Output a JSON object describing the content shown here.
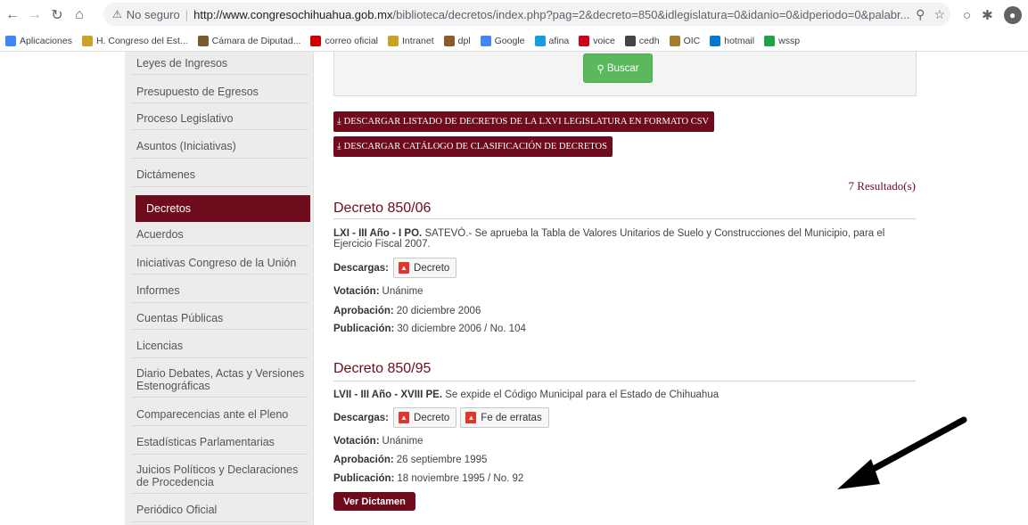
{
  "browser": {
    "security_label": "No seguro",
    "url_host": "http://www.congresochihuahua.gob.mx",
    "url_path": "/biblioteca/decretos/index.php?pag=2&decreto=850&idlegislatura=0&idanio=0&idperiodo=0&palabr...",
    "bookmarks": [
      {
        "label": "Aplicaciones",
        "color": "#4285f4"
      },
      {
        "label": "H. Congreso del Est...",
        "color": "#c9a227"
      },
      {
        "label": "Cámara de Diputad...",
        "color": "#7a5b2e"
      },
      {
        "label": "correo oficial",
        "color": "#cc0000"
      },
      {
        "label": "Intranet",
        "color": "#c9a227"
      },
      {
        "label": "dpl",
        "color": "#8a5a2b"
      },
      {
        "label": "Google",
        "color": "#4285f4"
      },
      {
        "label": "afina",
        "color": "#1a9be0"
      },
      {
        "label": "voice",
        "color": "#d0021b"
      },
      {
        "label": "cedh",
        "color": "#444444"
      },
      {
        "label": "OIC",
        "color": "#a57d2c"
      },
      {
        "label": "hotmail",
        "color": "#0078d4"
      },
      {
        "label": "wssp",
        "color": "#1ea446"
      }
    ]
  },
  "sidebar": {
    "items": [
      {
        "label": "Leyes de Ingresos",
        "active": false
      },
      {
        "label": "Presupuesto de Egresos",
        "active": false
      },
      {
        "label": "Proceso Legislativo",
        "active": false
      },
      {
        "label": "Asuntos (Iniciativas)",
        "active": false
      },
      {
        "label": "Dictámenes",
        "active": false
      },
      {
        "label": "Decretos",
        "active": true
      },
      {
        "label": "Acuerdos",
        "active": false
      },
      {
        "label": "Iniciativas Congreso de la Unión",
        "active": false
      },
      {
        "label": "Informes",
        "active": false
      },
      {
        "label": "Cuentas Públicas",
        "active": false
      },
      {
        "label": "Licencias",
        "active": false
      },
      {
        "label": "Diario Debates, Actas y Versiones Estenográficas",
        "active": false
      },
      {
        "label": "Comparecencias ante el Pleno",
        "active": false
      },
      {
        "label": "Estadísticas Parlamentarias",
        "active": false
      },
      {
        "label": "Juicios Políticos y Declaraciones de Procedencia",
        "active": false
      },
      {
        "label": "Periódico Oficial",
        "active": false
      }
    ]
  },
  "search": {
    "button_label": "Buscar"
  },
  "downloads": {
    "csv_label": "DESCARGAR LISTADO DE DECRETOS DE LA LXVI LEGISLATURA EN FORMATO CSV",
    "catalog_label": "DESCARGAR CATÁLOGO DE CLASIFICACIÓN DE DECRETOS"
  },
  "results_count": "7 Resultado(s)",
  "decretos": [
    {
      "title": "Decreto 850/06",
      "period": "LXI - III Año - I PO.",
      "description": "SATEVÓ.- Se aprueba la Tabla de Valores Unitarios de Suelo y Construcciones del Municipio, para el Ejercicio Fiscal 2007.",
      "descargas_label": "Descargas:",
      "files": [
        "Decreto"
      ],
      "votacion_label": "Votación:",
      "votacion": "Unánime",
      "aprobacion_label": "Aprobación:",
      "aprobacion": "20 diciembre 2006",
      "publicacion_label": "Publicación:",
      "publicacion": "30 diciembre 2006 / No. 104"
    },
    {
      "title": "Decreto 850/95",
      "period": "LVII - III Año - XVIII PE.",
      "description": "Se expide el Código Municipal para el Estado de Chihuahua",
      "descargas_label": "Descargas:",
      "files": [
        "Decreto",
        "Fe de erratas"
      ],
      "votacion_label": "Votación:",
      "votacion": "Unánime",
      "aprobacion_label": "Aprobación:",
      "aprobacion": "26 septiembre 1995",
      "publicacion_label": "Publicación:",
      "publicacion": "18 noviembre 1995 / No. 92",
      "dictamen_label": "Ver Dictamen"
    }
  ]
}
